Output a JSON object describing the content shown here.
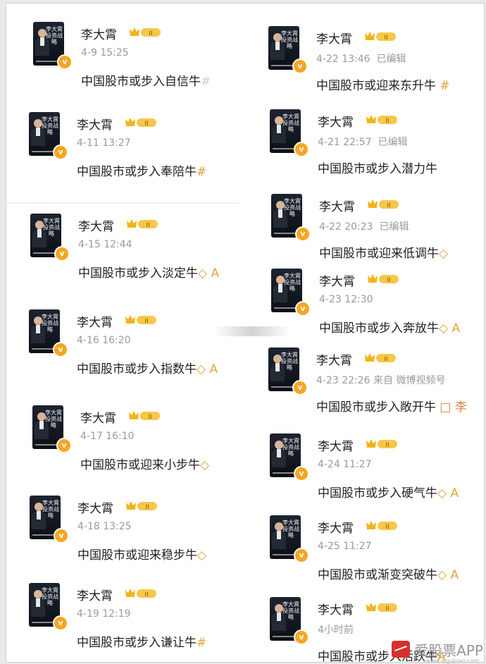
{
  "user": {
    "name": "李大霄",
    "crown_badge_text": "II",
    "verified_icon": "v-verified-icon",
    "avatar_cover_title": "李大霄投资战略"
  },
  "left_posts": [
    {
      "time": "4-9 15:25",
      "content": "中国股市或步入自信牛",
      "tail": "#"
    },
    {
      "time": "4-11 13:27",
      "content": "中国股市或步入奉陪牛",
      "tail": "#"
    },
    {
      "time": "4-15 12:44",
      "content": "中国股市或步入淡定牛",
      "tail": "◇ A"
    },
    {
      "time": "4-16 16:20",
      "content": "中国股市或步入指数牛",
      "tail": "◇ A"
    },
    {
      "time": "4-17 16:10",
      "content": "中国股市或迎来小步牛",
      "tail": "◇"
    },
    {
      "time": "4-18 13:25",
      "content": "中国股市或迎来稳步牛",
      "tail": "◇"
    },
    {
      "time": "4-19 12:19",
      "content": "中国股市或步入谦让牛",
      "tail": "#"
    }
  ],
  "right_posts": [
    {
      "time": "4-22 13:46",
      "edited": "已编辑",
      "content": "中国股市或迎来东升牛",
      "tail": "#"
    },
    {
      "time": "4-21 22:57",
      "edited": "已编辑",
      "content": "中国股市或步入潜力牛",
      "tail": ""
    },
    {
      "time": "4-22 20:23",
      "edited": "已编辑",
      "content": "中国股市或迎来低调牛",
      "tail": "◇"
    },
    {
      "time": "4-23 12:30",
      "edited": "",
      "content": "中国股市或步入奔放牛",
      "tail": "◇ A"
    },
    {
      "time": "4-23 22:26",
      "edited": "来自 微博视频号",
      "content": "中国股市或步入敞开牛",
      "tail": "□ 李"
    },
    {
      "time": "4-24 11:27",
      "edited": "",
      "content": "中国股市或步入硬气牛",
      "tail": "◇ A"
    },
    {
      "time": "4-25 11:27",
      "edited": "",
      "content": "中国股市或渐变突破牛",
      "tail": "◇ A"
    },
    {
      "time": "4小时前",
      "edited": "",
      "content": "中国股市或步入活跃牛",
      "tail": "A"
    }
  ],
  "watermark": {
    "text": "爱股票APP",
    "sub": "www.aigupiao.com",
    "logo_icon": "aigupiao-logo-icon"
  }
}
